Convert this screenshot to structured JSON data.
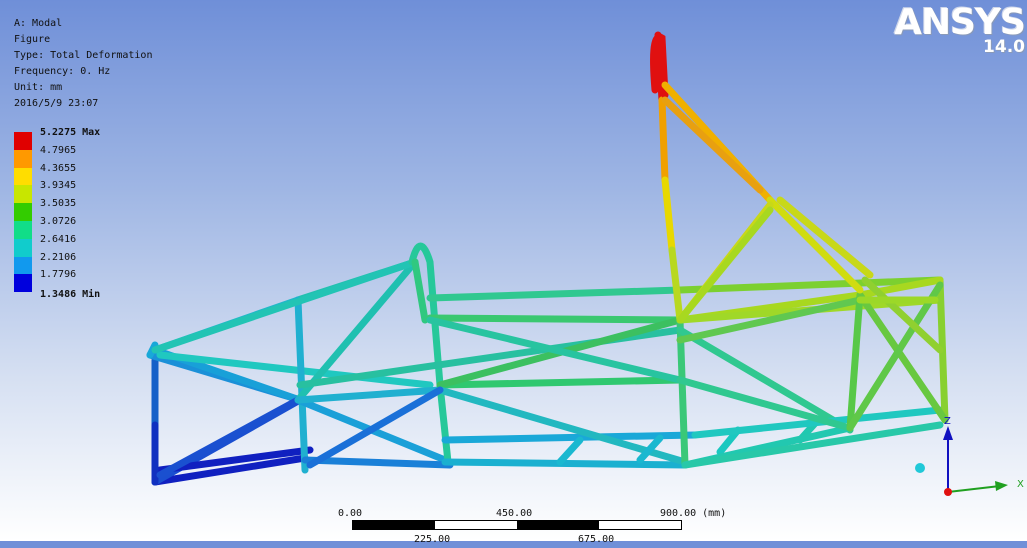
{
  "info": {
    "title": "A: Modal",
    "subtitle": "Figure",
    "type": "Type: Total Deformation",
    "frequency": "Frequency: 0. Hz",
    "unit": "Unit: mm",
    "timestamp": "2016/5/9 23:07"
  },
  "legend": {
    "max_label": "5.2275 Max",
    "min_label": "1.3486 Min",
    "values": [
      "4.7965",
      "4.3655",
      "3.9345",
      "3.5035",
      "3.0726",
      "2.6416",
      "2.2106",
      "1.7796"
    ],
    "colors": [
      "#e00000",
      "#ff9900",
      "#ffdd00",
      "#c8e600",
      "#33cc00",
      "#11dd88",
      "#11cccc",
      "#1199ee",
      "#0000dd"
    ]
  },
  "logo": {
    "name": "ANSYS",
    "version": "14.0"
  },
  "scale": {
    "tick_0": "0.00",
    "tick_450": "450.00",
    "tick_900": "900.00 (mm)",
    "tick_225": "225.00",
    "tick_675": "675.00"
  },
  "triad": {
    "z_label": "Z",
    "x_label": "X"
  },
  "colors": {
    "background_top": "#6f8fd8",
    "background_bottom": "#ffffff"
  }
}
